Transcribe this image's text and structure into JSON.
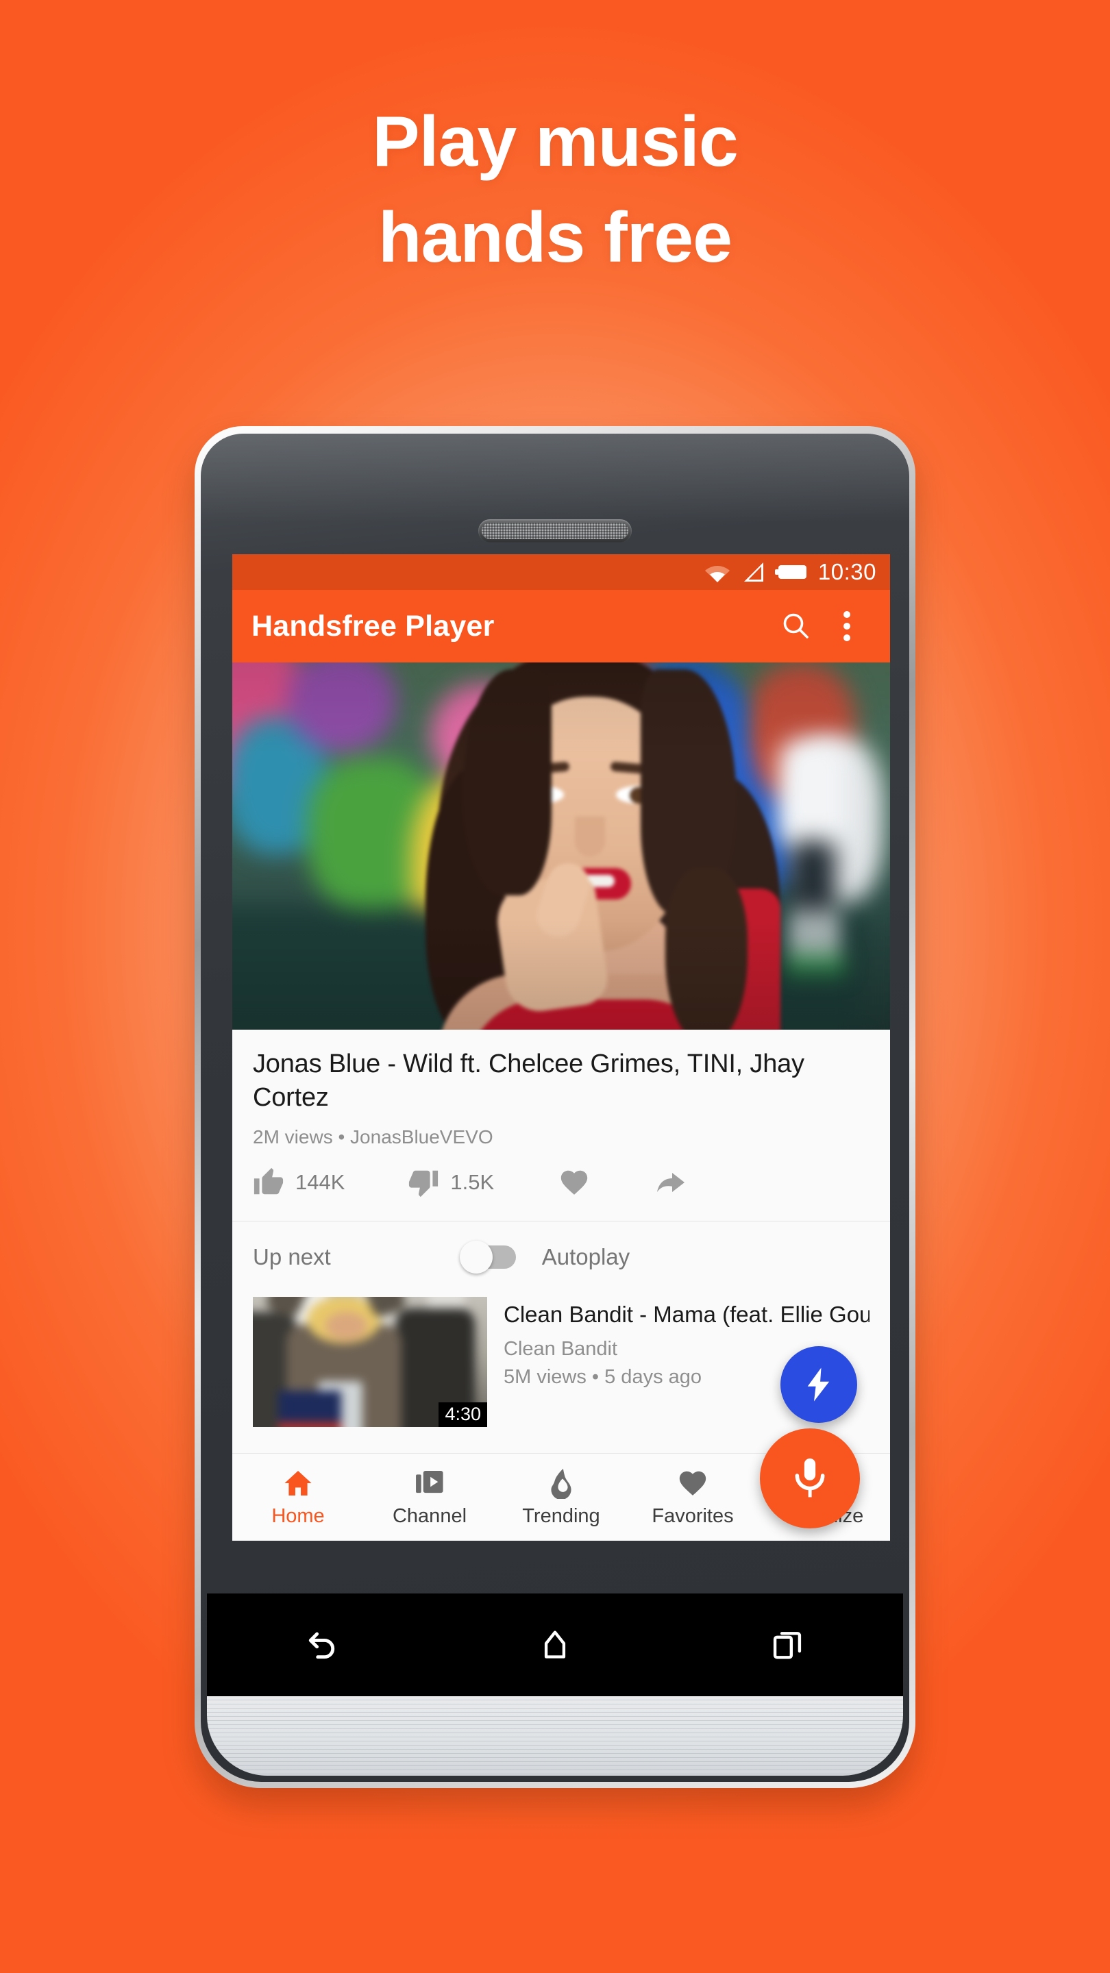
{
  "headline": {
    "line1": "Play music",
    "line2": "hands free"
  },
  "colors": {
    "background_outer": "#FA5A22",
    "background_center": "#FCAE8E",
    "brand_orange": "#F9551E",
    "statusbar_orange": "#DD4A18",
    "fab_blue": "#2B4CE0",
    "fab_orange": "#F9551E",
    "text_primary": "#1a1a1a",
    "text_secondary": "#8e8e8e"
  },
  "statusbar": {
    "time": "10:30",
    "icons": [
      "wifi-icon",
      "cell-signal-icon",
      "battery-icon"
    ]
  },
  "appbar": {
    "title": "Handsfree Player",
    "search_icon": "search-icon",
    "overflow_icon": "overflow-menu-icon"
  },
  "player": {
    "video_title": "Jonas Blue - Wild ft. Chelcee Grimes, TINI, Jhay Cortez",
    "views_channel": "2M views • JonasBlueVEVO",
    "actions": [
      {
        "icon": "thumb-up-icon",
        "count": "144K"
      },
      {
        "icon": "thumb-down-icon",
        "count": "1.5K"
      },
      {
        "icon": "heart-icon",
        "count": ""
      },
      {
        "icon": "share-icon",
        "count": ""
      }
    ]
  },
  "upnext": {
    "label": "Up next",
    "autoplay_label": "Autoplay",
    "autoplay_on": false,
    "item": {
      "title": "Clean Bandit - Mama (feat. Ellie Goulding) [Official",
      "channel": "Clean Bandit",
      "views": "5M views • 5 days ago",
      "duration": "4:30"
    }
  },
  "fabs": [
    {
      "name": "flash-fab",
      "icon": "lightning-bolt-icon",
      "color": "#2B4CE0"
    },
    {
      "name": "voice-fab",
      "icon": "microphone-icon",
      "color": "#F9551E"
    }
  ],
  "tabbar": {
    "active_index": 0,
    "tabs": [
      {
        "label": "Home",
        "icon": "home-icon"
      },
      {
        "label": "Channel",
        "icon": "channel-play-icon"
      },
      {
        "label": "Trending",
        "icon": "flame-icon"
      },
      {
        "label": "Favorites",
        "icon": "heart-icon"
      },
      {
        "label": "Minimize",
        "icon": "minimize-window-icon"
      }
    ]
  },
  "android_navbar": {
    "buttons": [
      {
        "name": "back-button",
        "icon": "back-arrow-icon"
      },
      {
        "name": "home-button",
        "icon": "home-pentagon-icon"
      },
      {
        "name": "recents-button",
        "icon": "recents-squares-icon"
      }
    ]
  }
}
